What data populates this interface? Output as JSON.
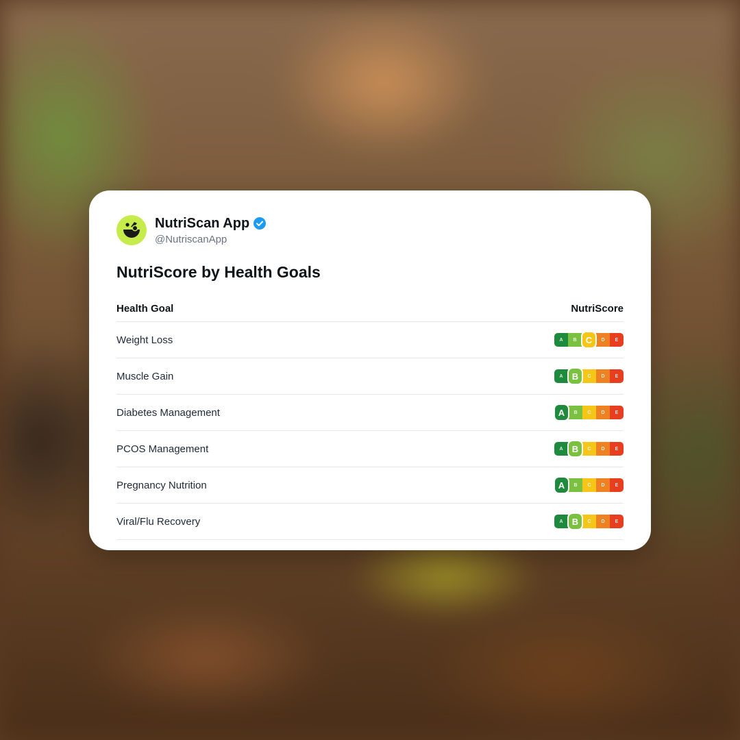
{
  "post": {
    "display_name": "NutriScan App",
    "handle": "@NutriscanApp",
    "verified": true,
    "avatar_icon": "nutriscan-logo-icon",
    "avatar_color": "#c5ec4a"
  },
  "title": "NutriScore by Health Goals",
  "table": {
    "headers": [
      "Health Goal",
      "NutriScore"
    ],
    "rows": [
      {
        "goal": "Weight Loss",
        "score": "C"
      },
      {
        "goal": "Muscle Gain",
        "score": "B"
      },
      {
        "goal": "Diabetes Management",
        "score": "A"
      },
      {
        "goal": "PCOS Management",
        "score": "B"
      },
      {
        "goal": "Pregnancy Nutrition",
        "score": "A"
      },
      {
        "goal": "Viral/Flu Recovery",
        "score": "B"
      }
    ]
  },
  "nutriscore_scale": {
    "grades": [
      "A",
      "B",
      "C",
      "D",
      "E"
    ],
    "colors": [
      "#1e8a3e",
      "#7ac142",
      "#f5c518",
      "#ee8122",
      "#e63e1f"
    ]
  }
}
